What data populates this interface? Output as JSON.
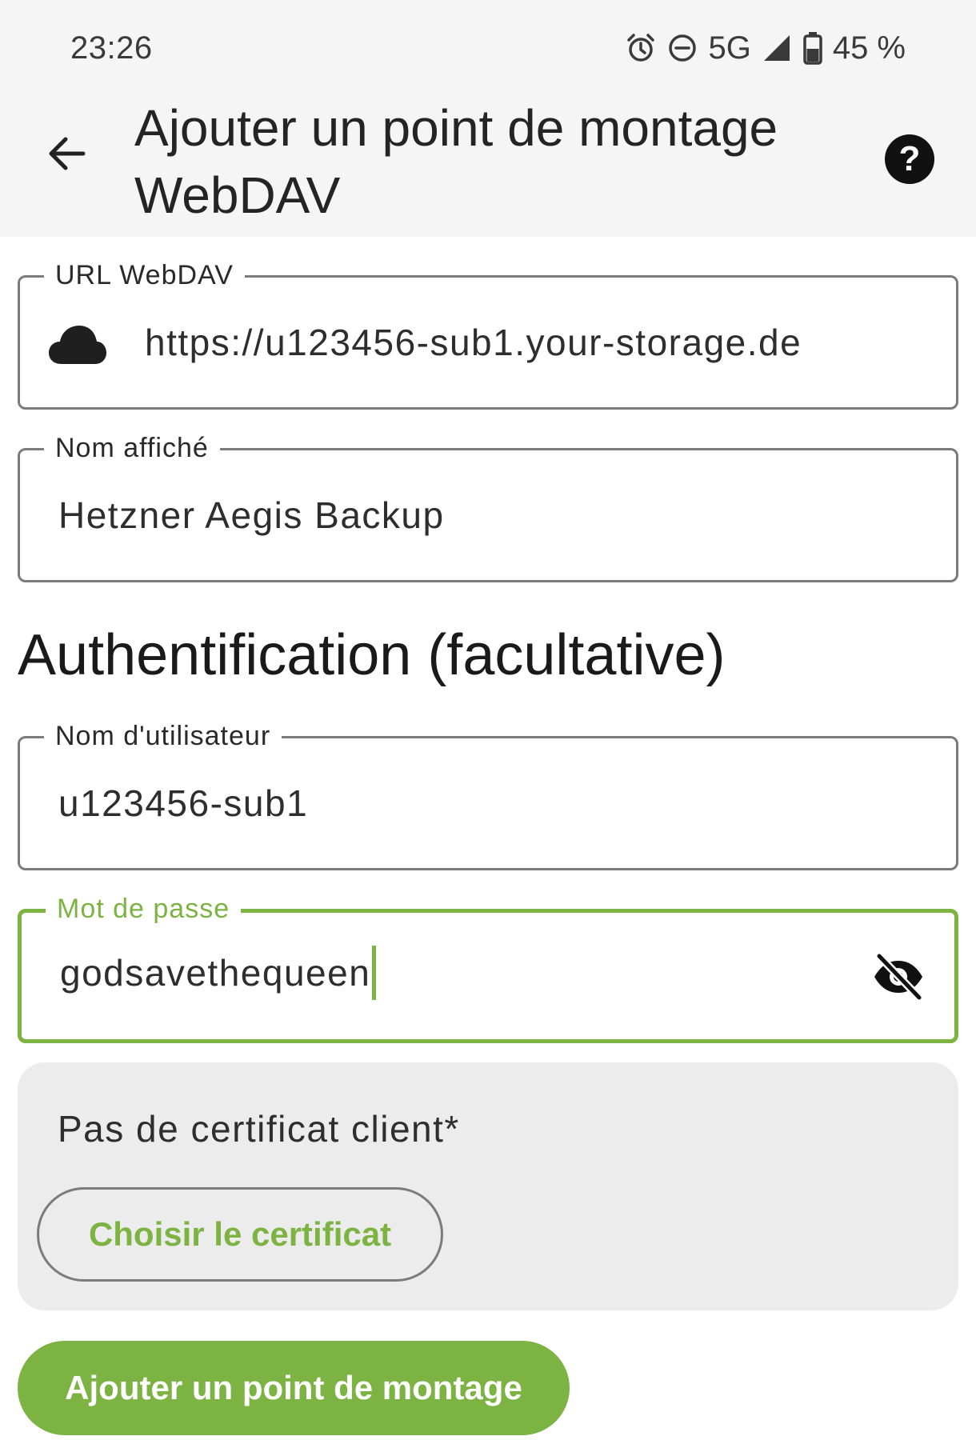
{
  "status_bar": {
    "time": "23:26",
    "network": "5G",
    "battery": "45 %",
    "icons": [
      "alarm-icon",
      "do-not-disturb-icon",
      "signal-icon",
      "battery-icon"
    ]
  },
  "header": {
    "title": "Ajouter un point de montage WebDAV",
    "back_icon": "arrow-left-icon",
    "help_icon": "help-circle-icon"
  },
  "form": {
    "url": {
      "label": "URL WebDAV",
      "value": "https://u123456-sub1.your-storage.de",
      "icon": "cloud-icon"
    },
    "display_name": {
      "label": "Nom affiché",
      "value": "Hetzner Aegis Backup"
    },
    "auth_heading": "Authentification (facultative)",
    "username": {
      "label": "Nom d'utilisateur",
      "value": "u123456-sub1"
    },
    "password": {
      "label": "Mot de passe",
      "value": "godsavethequeen",
      "toggle_icon": "eye-off-icon",
      "focused": true
    }
  },
  "certificate": {
    "status": "Pas de certificat client*",
    "choose_label": "Choisir le certificat"
  },
  "actions": {
    "submit_label": "Ajouter un point de montage"
  },
  "colors": {
    "accent": "#7cb342",
    "surface": "#f5f5f5",
    "card": "#ececec",
    "outline": "#7b7b7b"
  }
}
